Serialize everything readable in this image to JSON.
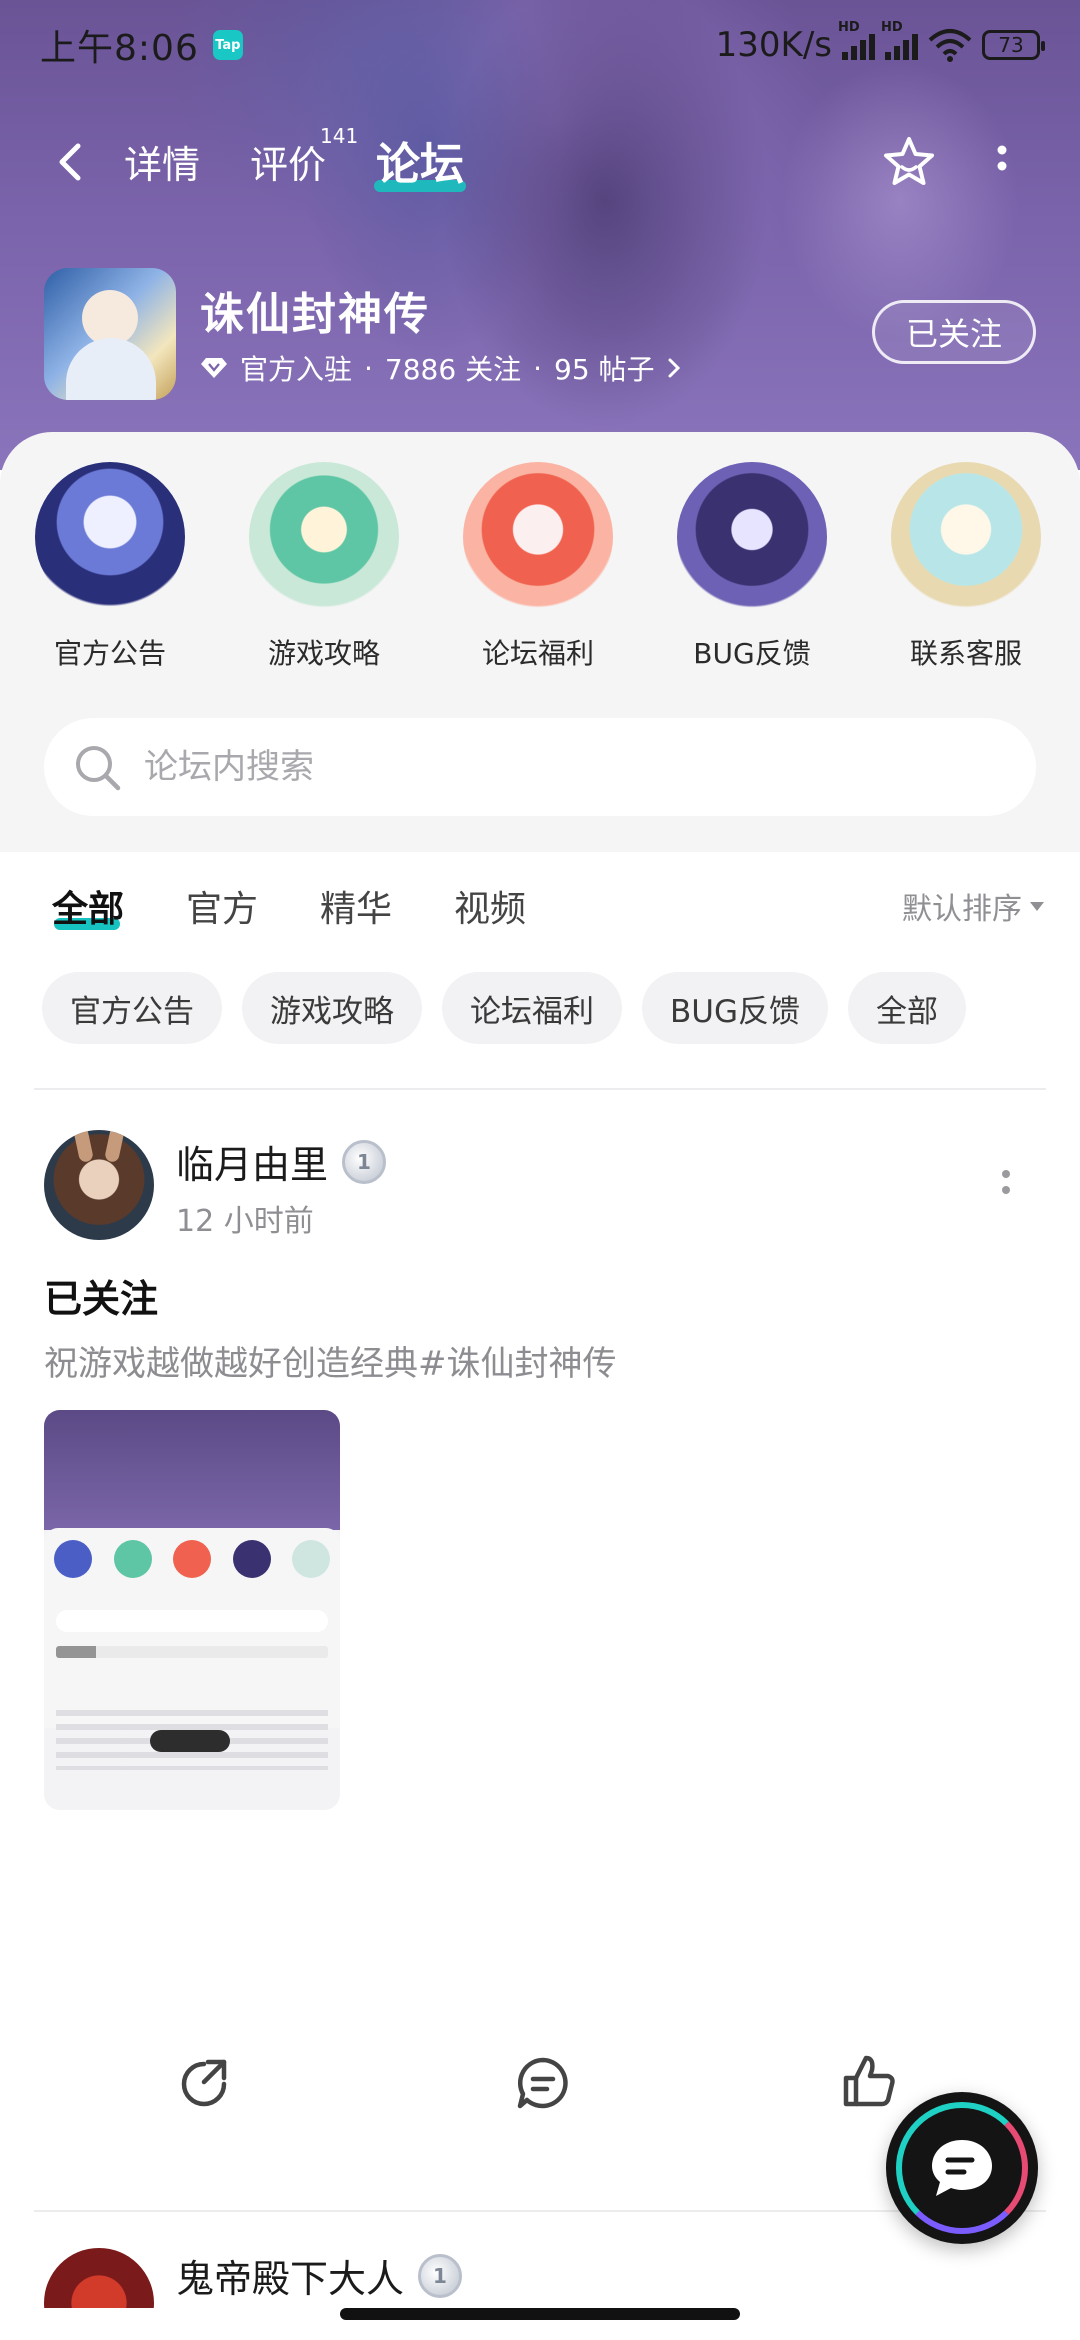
{
  "status_bar": {
    "time": "上午8:06",
    "app_badge": "Tap",
    "network_speed": "130K/s",
    "signal_label": "HD",
    "battery": "73"
  },
  "nav": {
    "tabs": [
      {
        "label": "详情"
      },
      {
        "label": "评价",
        "count": "141"
      },
      {
        "label": "论坛"
      }
    ],
    "active_tab": "论坛"
  },
  "game": {
    "title": "诛仙封神传",
    "status": "官方入驻",
    "separator": "·",
    "followers": "7886 关注",
    "posts": "95 帖子",
    "follow_button": "已关注"
  },
  "categories": [
    {
      "label": "官方公告"
    },
    {
      "label": "游戏攻略"
    },
    {
      "label": "论坛福利"
    },
    {
      "label": "BUG反馈"
    },
    {
      "label": "联系客服"
    }
  ],
  "search": {
    "placeholder": "论坛内搜索"
  },
  "feed_tabs": [
    {
      "label": "全部"
    },
    {
      "label": "官方"
    },
    {
      "label": "精华"
    },
    {
      "label": "视频"
    }
  ],
  "feed_active": "全部",
  "sort_label": "默认排序",
  "chips": [
    {
      "label": "官方公告"
    },
    {
      "label": "游戏攻略"
    },
    {
      "label": "论坛福利"
    },
    {
      "label": "BUG反馈"
    },
    {
      "label": "全部"
    }
  ],
  "post": {
    "author": "临月由里",
    "level": "1",
    "time": "12 小时前",
    "title": "已关注",
    "body": "祝游戏越做越好创造经典#诛仙封神传"
  },
  "next_post": {
    "author": "鬼帝殿下大人",
    "level": "1"
  },
  "colors": {
    "accent": "#17c3c0",
    "hero": "#7a63aa"
  }
}
